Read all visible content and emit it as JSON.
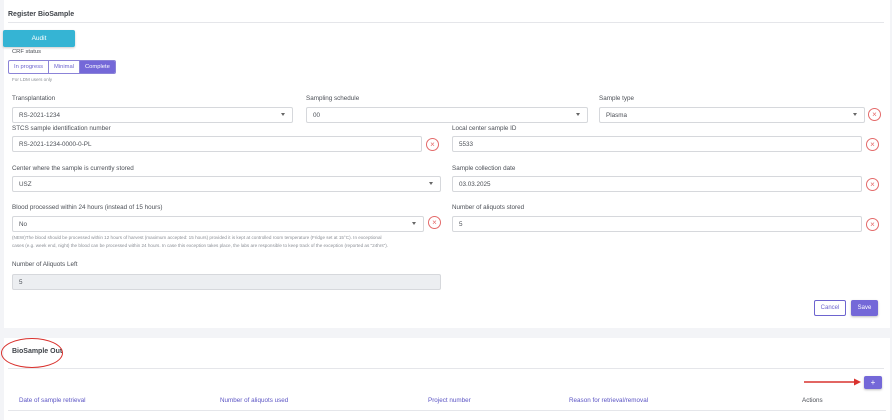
{
  "register": {
    "title": "Register BioSample",
    "audit_label": "Audit",
    "crf_status_label": "CRF status",
    "crf_options": [
      "In progress",
      "Minimal",
      "Complete"
    ],
    "crf_selected": "Complete",
    "crf_hint": "For LDM users only"
  },
  "fields": {
    "transplantation": {
      "label": "Transplantation",
      "value": "RS-2021-1234"
    },
    "sampling_schedule": {
      "label": "Sampling schedule",
      "value": "00"
    },
    "sample_type": {
      "label": "Sample type",
      "value": "Plasma"
    },
    "stcs_id": {
      "label": "STCS sample identification number",
      "value": "RS-2021-1234-0000-0-PL"
    },
    "local_id": {
      "label": "Local center sample ID",
      "value": "5533"
    },
    "center": {
      "label": "Center where the sample is currently stored",
      "value": "USZ"
    },
    "collection_date": {
      "label": "Sample collection date",
      "value": "03.03.2025"
    },
    "blood_processed": {
      "label": "Blood processed within 24 hours (instead of 15 hours)",
      "value": "No"
    },
    "aliquots_stored": {
      "label": "Number of aliquots stored",
      "value": "5"
    },
    "aliquots_left": {
      "label": "Number of Aliquots Left",
      "value": "5"
    }
  },
  "note_line1": "(NEW)The blood should be processed within 12 hours of harvest (maximum accepted: 15 hours) provided it is kept at controlled room temperature (Fridge set at 15°C). In exceptional",
  "note_line2": "cases (e.g. week end, night) the blood can be processed within 24 hours. In case this exception takes place, the labs are responsible to keep track of the exception (reported as \"24hrs\").",
  "actions": {
    "cancel": "Cancel",
    "save": "Save"
  },
  "out": {
    "title": "BioSample Out",
    "add_label": "+",
    "columns": [
      "Date of sample retrieval",
      "Number of aliquots used",
      "Project number",
      "Reason for retrieval/removal",
      "Actions"
    ]
  },
  "icons": {
    "clear": "close-circle-icon",
    "dropdown": "chevron-down-icon",
    "annotation_arrow": "arrow-right-icon"
  },
  "colors": {
    "primary": "#7468d8",
    "audit": "#35b4d4",
    "danger": "#e46a6a",
    "annotation": "#d9322e"
  }
}
